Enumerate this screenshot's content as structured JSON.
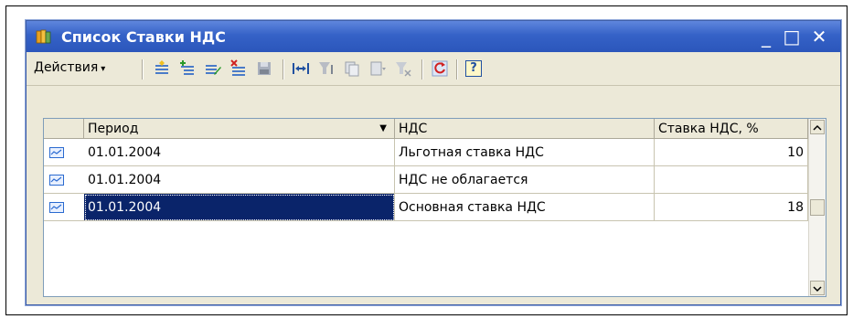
{
  "window": {
    "title": "Список Ставки НДС",
    "minimize": "_",
    "maximize": "□",
    "close": "✕"
  },
  "toolbar": {
    "actions_label": "Действия",
    "actions_caret": "▾",
    "icons": [
      "add-row-icon",
      "add-group-icon",
      "edit-icon",
      "delete-icon",
      "save-icon",
      "column-width-icon",
      "filter-icon",
      "copy-icon",
      "move-icon",
      "clear-filter-icon",
      "refresh-icon",
      "help-icon"
    ],
    "help_label": "?"
  },
  "table": {
    "columns": [
      {
        "key": "period",
        "label": "Период",
        "sort": "▼"
      },
      {
        "key": "vat",
        "label": "НДС"
      },
      {
        "key": "rate",
        "label": "Ставка НДС, %"
      }
    ],
    "rows": [
      {
        "period": "01.01.2004",
        "vat": "Льготная ставка НДС",
        "rate": "10",
        "selected": false
      },
      {
        "period": "01.01.2004",
        "vat": "НДС не облагается",
        "rate": "",
        "selected": false
      },
      {
        "period": "01.01.2004",
        "vat": "Основная ставка НДС",
        "rate": "18",
        "selected": true
      }
    ]
  },
  "colors": {
    "title_bar": "#3562c7",
    "selection": "#0a246a",
    "window_bg": "#ece9d8"
  }
}
